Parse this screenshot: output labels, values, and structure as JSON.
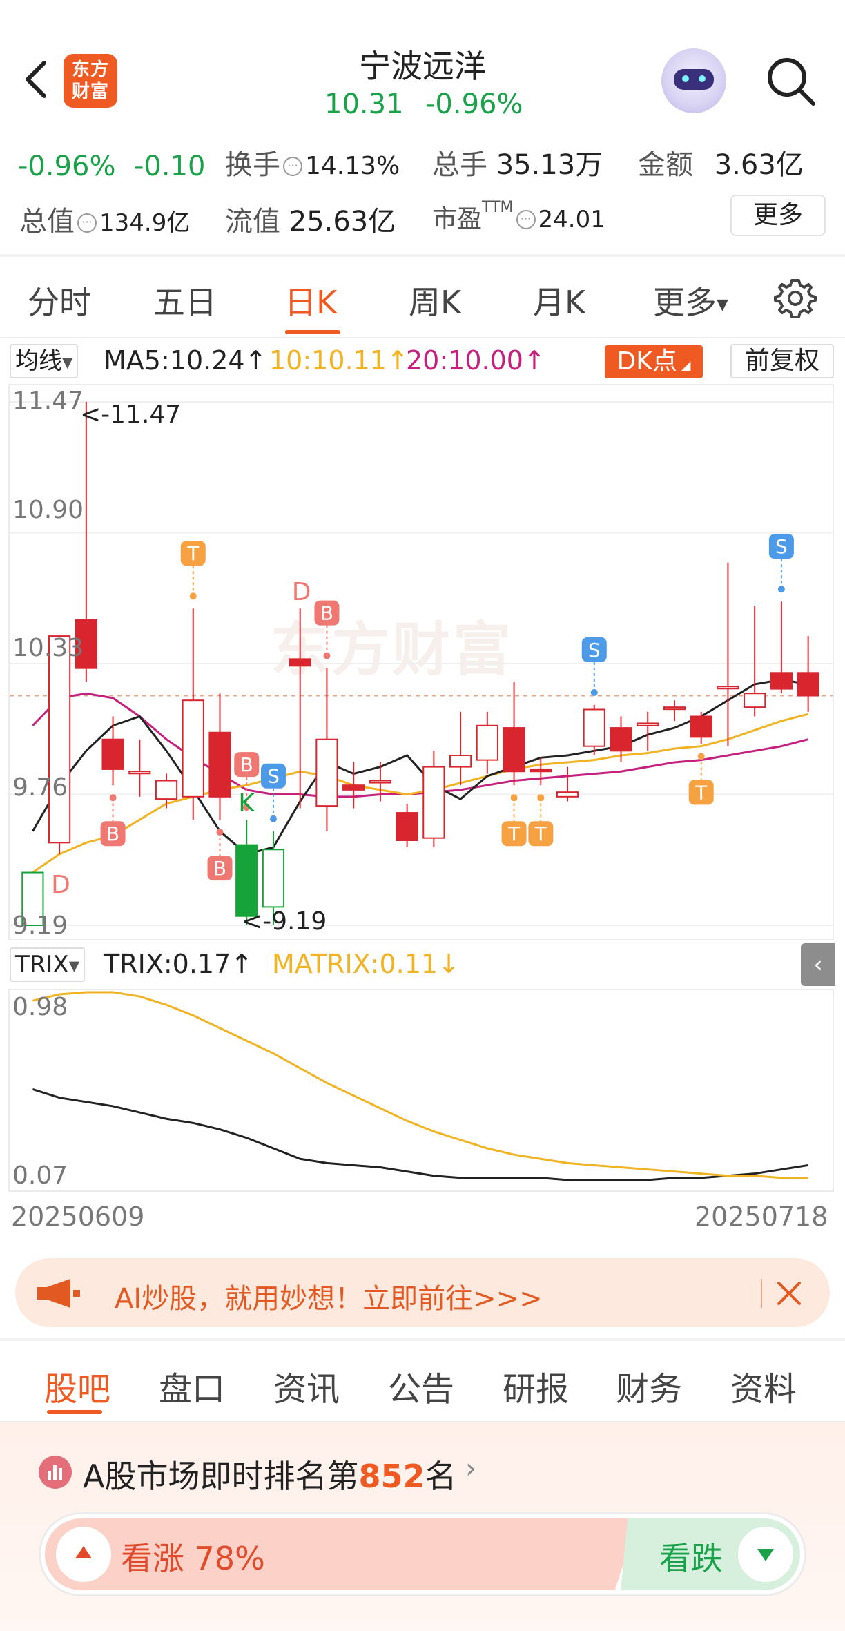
{
  "header": {
    "logo_text_1": "东方",
    "logo_text_2": "财富",
    "stock_name": "宁波远洋",
    "price": "10.31",
    "change_pct": "-0.96%"
  },
  "quote": {
    "change_pct": "-0.96%",
    "change_amt": "-0.10",
    "turnover_label": "换手",
    "turnover_value": "14.13%",
    "volume_label": "总手",
    "volume_value": "35.13万",
    "amount_label": "金额",
    "amount_value": "3.63亿",
    "total_cap_label": "总值",
    "total_cap_value": "134.9亿",
    "float_cap_label": "流值",
    "float_cap_value": "25.63亿",
    "pe_label": "市盈",
    "pe_sup": "TTM",
    "pe_value": "24.01",
    "more_label": "更多",
    "info_glyph": "···"
  },
  "period_tabs": [
    "分时",
    "五日",
    "日K",
    "周K",
    "月K",
    "更多"
  ],
  "active_period": "日K",
  "ma_row": {
    "selector_label": "均线",
    "ma5": "MA5:10.24↑",
    "ma10": "10:10.11↑",
    "ma20": "20:10.00↑",
    "dk_button": "DK点",
    "adjust_button": "前复权"
  },
  "colors": {
    "accent": "#ef5a23",
    "up_red": "#d9262e",
    "down_green": "#16a43a",
    "ma5": "#222222",
    "ma10": "#f0b323",
    "ma20": "#c4207e",
    "signal_s": "#4d9be8",
    "signal_t": "#f6a243",
    "signal_b": "#f07873"
  },
  "kline": {
    "watermark": "东方财富",
    "y_labels": [
      "11.47",
      "10.90",
      "10.33",
      "9.76",
      "9.19"
    ],
    "high_annotation": "<-11.47",
    "low_annotation": "<-9.19"
  },
  "trix": {
    "selector_label": "TRIX",
    "trix_value": "TRIX:0.17↑",
    "matrix_value": "MATRIX:0.11↓",
    "y_labels": [
      "0.98",
      "0.07"
    ],
    "collapse_glyph": "‹"
  },
  "dates": {
    "start": "20250609",
    "end": "20250718"
  },
  "chart_data": [
    {
      "type": "candlestick",
      "ylim": [
        9.19,
        11.47
      ],
      "y_ticks": [
        11.47,
        10.9,
        10.33,
        9.76,
        9.19
      ],
      "candles": [
        {
          "o": 9.19,
          "c": 9.42,
          "h": 9.42,
          "l": 9.19
        },
        {
          "o": 9.55,
          "c": 10.45,
          "h": 10.45,
          "l": 9.5
        },
        {
          "o": 10.52,
          "c": 10.31,
          "h": 11.47,
          "l": 10.25
        },
        {
          "o": 10.0,
          "c": 9.87,
          "h": 10.1,
          "l": 9.8
        },
        {
          "o": 9.86,
          "c": 9.86,
          "h": 10.0,
          "l": 9.75
        },
        {
          "o": 9.74,
          "c": 9.82,
          "h": 9.85,
          "l": 9.7
        },
        {
          "o": 9.75,
          "c": 10.17,
          "h": 10.57,
          "l": 9.65
        },
        {
          "o": 10.03,
          "c": 9.75,
          "h": 10.2,
          "l": 9.65
        },
        {
          "o": 9.54,
          "c": 9.23,
          "h": 9.65,
          "l": 9.19
        },
        {
          "o": 9.27,
          "c": 9.52,
          "h": 9.6,
          "l": 9.19
        },
        {
          "o": 10.35,
          "c": 10.32,
          "h": 10.57,
          "l": 9.7
        },
        {
          "o": 9.71,
          "c": 10.0,
          "h": 10.31,
          "l": 9.6
        },
        {
          "o": 9.8,
          "c": 9.78,
          "h": 9.9,
          "l": 9.7
        },
        {
          "o": 9.82,
          "c": 9.82,
          "h": 9.9,
          "l": 9.73
        },
        {
          "o": 9.68,
          "c": 9.56,
          "h": 9.72,
          "l": 9.53
        },
        {
          "o": 9.57,
          "c": 9.88,
          "h": 9.95,
          "l": 9.53
        },
        {
          "o": 9.88,
          "c": 9.93,
          "h": 10.12,
          "l": 9.8
        },
        {
          "o": 9.91,
          "c": 10.06,
          "h": 10.12,
          "l": 9.85
        },
        {
          "o": 10.05,
          "c": 9.86,
          "h": 10.25,
          "l": 9.8
        },
        {
          "o": 9.87,
          "c": 9.86,
          "h": 9.92,
          "l": 9.8
        },
        {
          "o": 9.75,
          "c": 9.77,
          "h": 9.88,
          "l": 9.73
        },
        {
          "o": 9.97,
          "c": 10.13,
          "h": 10.15,
          "l": 9.93
        },
        {
          "o": 10.05,
          "c": 9.95,
          "h": 10.1,
          "l": 9.9
        },
        {
          "o": 10.06,
          "c": 10.07,
          "h": 10.12,
          "l": 9.95
        },
        {
          "o": 10.14,
          "c": 10.14,
          "h": 10.17,
          "l": 10.08
        },
        {
          "o": 10.1,
          "c": 10.01,
          "h": 10.12,
          "l": 9.98
        },
        {
          "o": 10.23,
          "c": 10.23,
          "h": 10.77,
          "l": 9.97
        },
        {
          "o": 10.14,
          "c": 10.2,
          "h": 10.58,
          "l": 10.1
        },
        {
          "o": 10.29,
          "c": 10.22,
          "h": 10.6,
          "l": 10.2
        },
        {
          "o": 10.29,
          "c": 10.19,
          "h": 10.45,
          "l": 10.12
        }
      ],
      "ma5": [
        9.6,
        9.8,
        9.95,
        10.06,
        10.1,
        9.95,
        9.78,
        9.6,
        9.5,
        9.53,
        9.73,
        9.9,
        9.85,
        9.88,
        9.93,
        9.8,
        9.74,
        9.84,
        9.88,
        9.92,
        9.93,
        9.95,
        9.97,
        10.02,
        10.05,
        10.1,
        10.17,
        10.24,
        10.26,
        10.24
      ],
      "ma10": [
        9.42,
        9.5,
        9.55,
        9.58,
        9.65,
        9.72,
        9.75,
        9.78,
        9.8,
        9.83,
        9.86,
        9.84,
        9.8,
        9.78,
        9.76,
        9.78,
        9.81,
        9.84,
        9.87,
        9.89,
        9.9,
        9.91,
        9.93,
        9.94,
        9.96,
        9.97,
        10.0,
        10.04,
        10.08,
        10.11
      ],
      "ma20": [
        10.06,
        10.18,
        10.2,
        10.18,
        10.1,
        10.0,
        9.92,
        9.85,
        9.78,
        9.76,
        9.76,
        9.75,
        9.75,
        9.76,
        9.76,
        9.77,
        9.78,
        9.8,
        9.82,
        9.83,
        9.84,
        9.85,
        9.86,
        9.88,
        9.9,
        9.91,
        9.93,
        9.95,
        9.97,
        10.0
      ],
      "signals": [
        {
          "i": 1,
          "type": "D",
          "pos": "below"
        },
        {
          "i": 3,
          "type": "B",
          "pos": "below"
        },
        {
          "i": 6,
          "type": "T",
          "pos": "above"
        },
        {
          "i": 7,
          "type": "B",
          "pos": "below"
        },
        {
          "i": 8,
          "type": "B",
          "pos": "above"
        },
        {
          "i": 8,
          "type": "K",
          "pos": "above"
        },
        {
          "i": 9,
          "type": "S",
          "pos": "above"
        },
        {
          "i": 10,
          "type": "D",
          "pos": "above"
        },
        {
          "i": 11,
          "type": "B",
          "pos": "above"
        },
        {
          "i": 18,
          "type": "T",
          "pos": "below"
        },
        {
          "i": 19,
          "type": "T",
          "pos": "below"
        },
        {
          "i": 21,
          "type": "S",
          "pos": "above"
        },
        {
          "i": 25,
          "type": "T",
          "pos": "below"
        },
        {
          "i": 28,
          "type": "S",
          "pos": "above"
        }
      ]
    },
    {
      "type": "line",
      "title": "TRIX",
      "ylim": [
        0.07,
        0.98
      ],
      "series": [
        {
          "name": "TRIX",
          "values": [
            0.53,
            0.49,
            0.47,
            0.45,
            0.42,
            0.39,
            0.37,
            0.34,
            0.3,
            0.25,
            0.2,
            0.18,
            0.17,
            0.16,
            0.14,
            0.12,
            0.11,
            0.11,
            0.11,
            0.11,
            0.1,
            0.1,
            0.1,
            0.1,
            0.11,
            0.11,
            0.12,
            0.13,
            0.15,
            0.17
          ]
        },
        {
          "name": "MATRIX",
          "values": [
            0.95,
            0.98,
            0.99,
            0.99,
            0.97,
            0.93,
            0.88,
            0.82,
            0.76,
            0.7,
            0.63,
            0.56,
            0.5,
            0.44,
            0.38,
            0.33,
            0.29,
            0.25,
            0.22,
            0.2,
            0.18,
            0.17,
            0.16,
            0.15,
            0.14,
            0.13,
            0.12,
            0.12,
            0.11,
            0.11
          ]
        }
      ]
    }
  ],
  "banner": {
    "text": "AI炒股，就用妙想！立即前往>>>"
  },
  "bottom_tabs": [
    "股吧",
    "盘口",
    "资讯",
    "公告",
    "研报",
    "财务",
    "资料"
  ],
  "active_bottom_tab": "股吧",
  "rank": {
    "prefix": "A股市场即时排名第",
    "number": "852",
    "suffix": "名"
  },
  "vote": {
    "up_label": "看涨 78%",
    "up_ratio": 0.78,
    "down_label": "看跌"
  }
}
